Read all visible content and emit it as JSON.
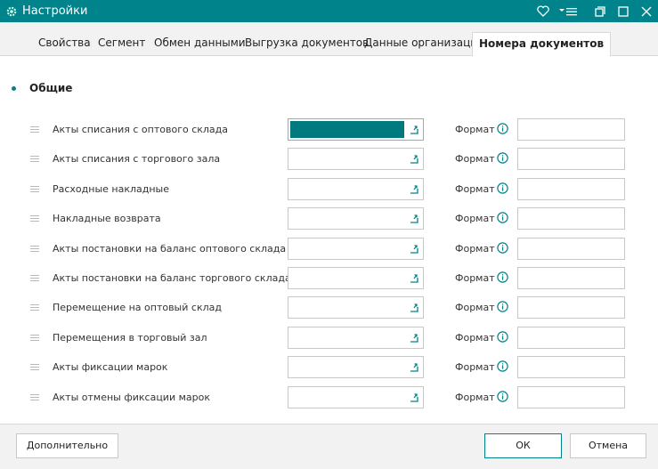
{
  "window": {
    "title": "Настройки"
  },
  "tabs": [
    {
      "label": "Свойства"
    },
    {
      "label": "Сегмент"
    },
    {
      "label": "Обмен данными"
    },
    {
      "label": "Выгрузка документов"
    },
    {
      "label": "Данные организации"
    },
    {
      "label": "Номера документов",
      "active": true
    }
  ],
  "section": {
    "title": "Общие"
  },
  "format_label": "Формат",
  "rows": [
    {
      "label": "Акты списания с оптового склада",
      "value": "",
      "format": ""
    },
    {
      "label": "Акты списания с торгового зала",
      "value": "",
      "format": ""
    },
    {
      "label": "Расходные накладные",
      "value": "",
      "format": ""
    },
    {
      "label": "Накладные возврата",
      "value": "",
      "format": ""
    },
    {
      "label": "Акты постановки на баланс оптового склада",
      "value": "",
      "format": ""
    },
    {
      "label": "Акты постановки на баланс торгового склада",
      "value": "",
      "format": ""
    },
    {
      "label": "Перемещение на оптовый склад",
      "value": "",
      "format": ""
    },
    {
      "label": "Перемещения в торговый зал",
      "value": "",
      "format": ""
    },
    {
      "label": "Акты фиксации марок",
      "value": "",
      "format": ""
    },
    {
      "label": "Акты отмены фиксации марок",
      "value": "",
      "format": ""
    }
  ],
  "footer": {
    "more_label": "Дополнительно",
    "ok_label": "ОК",
    "cancel_label": "Отмена"
  },
  "colors": {
    "accent": "#00838a",
    "selection": "#00797f"
  },
  "icons": [
    "gear-icon",
    "heart-icon",
    "menu-icon",
    "restore-icon",
    "maximize-icon",
    "close-icon",
    "info-icon",
    "picker-icon",
    "drag-handle-icon"
  ]
}
